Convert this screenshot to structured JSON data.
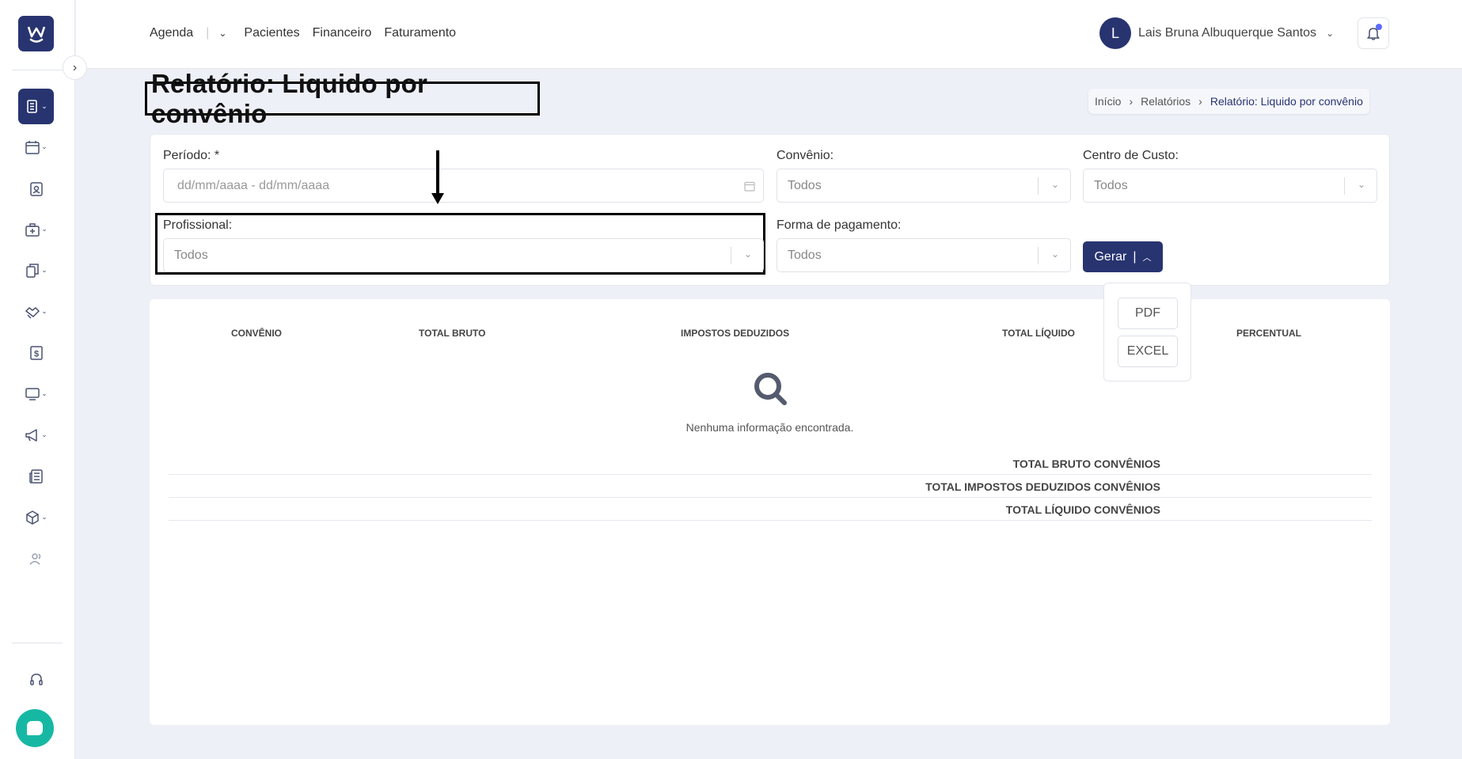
{
  "app": {
    "logo_letter": "W"
  },
  "topnav": {
    "items": [
      "Agenda",
      "Pacientes",
      "Financeiro",
      "Faturamento"
    ],
    "user_initial": "L",
    "user_name": "Lais Bruna Albuquerque Santos"
  },
  "sidebar": {
    "icons": [
      "reports-icon",
      "calendar-icon",
      "patient-icon",
      "clinic-icon",
      "documents-icon",
      "handshake-icon",
      "finance-icon",
      "monitor-icon",
      "megaphone-icon",
      "news-icon",
      "box-icon",
      "users-icon",
      "headset-icon",
      "chat-icon"
    ]
  },
  "page": {
    "title": "Relatório: Liquido por convênio",
    "breadcrumb": [
      "Início",
      "Relatórios",
      "Relatório: Liquido por convênio"
    ]
  },
  "filters": {
    "periodo_label": "Período: *",
    "periodo_placeholder": "dd/mm/aaaa - dd/mm/aaaa",
    "convenio_label": "Convênio:",
    "convenio_value": "Todos",
    "centro_label": "Centro de Custo:",
    "centro_value": "Todos",
    "profissional_label": "Profissional:",
    "profissional_value": "Todos",
    "forma_label": "Forma de pagamento:",
    "forma_value": "Todos",
    "gerar_label": "Gerar",
    "export_options": [
      "PDF",
      "EXCEL"
    ]
  },
  "table": {
    "columns": [
      "CONVÊNIO",
      "TOTAL BRUTO",
      "IMPOSTOS DEDUZIDOS",
      "TOTAL LÍQUIDO",
      "PERCENTUAL"
    ],
    "empty_message": "Nenhuma informação encontrada.",
    "totals": [
      "TOTAL BRUTO CONVÊNIOS",
      "TOTAL IMPOSTOS DEDUZIDOS CONVÊNIOS",
      "TOTAL LÍQUIDO CONVÊNIOS"
    ]
  },
  "colors": {
    "primary": "#283470",
    "chat": "#17b8a3",
    "notification": "#5c6bff"
  }
}
